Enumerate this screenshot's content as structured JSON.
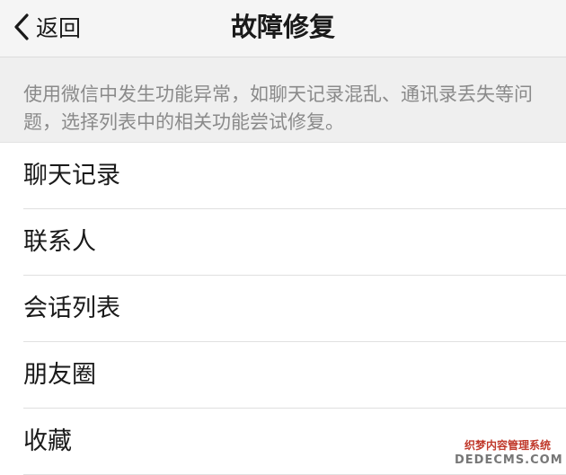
{
  "nav": {
    "back_label": "返回",
    "title": "故障修复",
    "back_icon": "chevron-left-icon"
  },
  "description": "使用微信中发生功能异常，如聊天记录混乱、通讯录丢失等问题，选择列表中的相关功能尝试修复。",
  "items": [
    {
      "label": "聊天记录"
    },
    {
      "label": "联系人"
    },
    {
      "label": "会话列表"
    },
    {
      "label": "朋友圈"
    },
    {
      "label": "收藏"
    }
  ],
  "watermark": {
    "line1": "织梦内容管理系统",
    "line2": "DEDECMS.COM"
  },
  "colors": {
    "nav_bg": "#f5f5f5",
    "description_bg": "#efefef",
    "description_text": "#8a8a8a",
    "list_bg": "#ffffff"
  }
}
